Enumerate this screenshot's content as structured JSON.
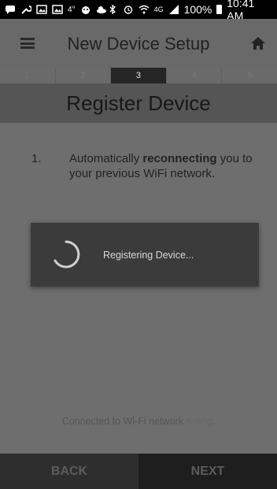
{
  "status_bar": {
    "icons_left": [
      "message-icon",
      "wrench-icon",
      "gallery-icon",
      "gallery-icon",
      "temperature-icon",
      "android-icon",
      "cloud-icon"
    ],
    "temperature": "4°",
    "battery_percent": "100%",
    "time": "10:41 AM",
    "network": "4G"
  },
  "app_bar": {
    "title": "New Device Setup",
    "menu_icon": "hamburger-icon",
    "home_icon": "home-icon"
  },
  "steps": {
    "items": [
      "1",
      "2",
      "3",
      "4",
      "5"
    ],
    "active_index": 2
  },
  "section": {
    "title": "Register Device"
  },
  "instruction": {
    "number": "1.",
    "text_before": "Automatically ",
    "text_bold": "reconnecting",
    "text_after": " you to your previous WiFi network."
  },
  "dialog": {
    "message": "Registering Device...",
    "spinner_icon": "spinner-icon"
  },
  "footer": {
    "connected_prefix": "Connected to Wi-Fi network ",
    "network_name": "Krang",
    "connected_suffix": "."
  },
  "nav": {
    "back_label": "BACK",
    "next_label": "NEXT"
  },
  "colors": {
    "overlay": "#6e6e6e",
    "active_step": "#262626",
    "dialog_bg": "#3b3b3b"
  }
}
